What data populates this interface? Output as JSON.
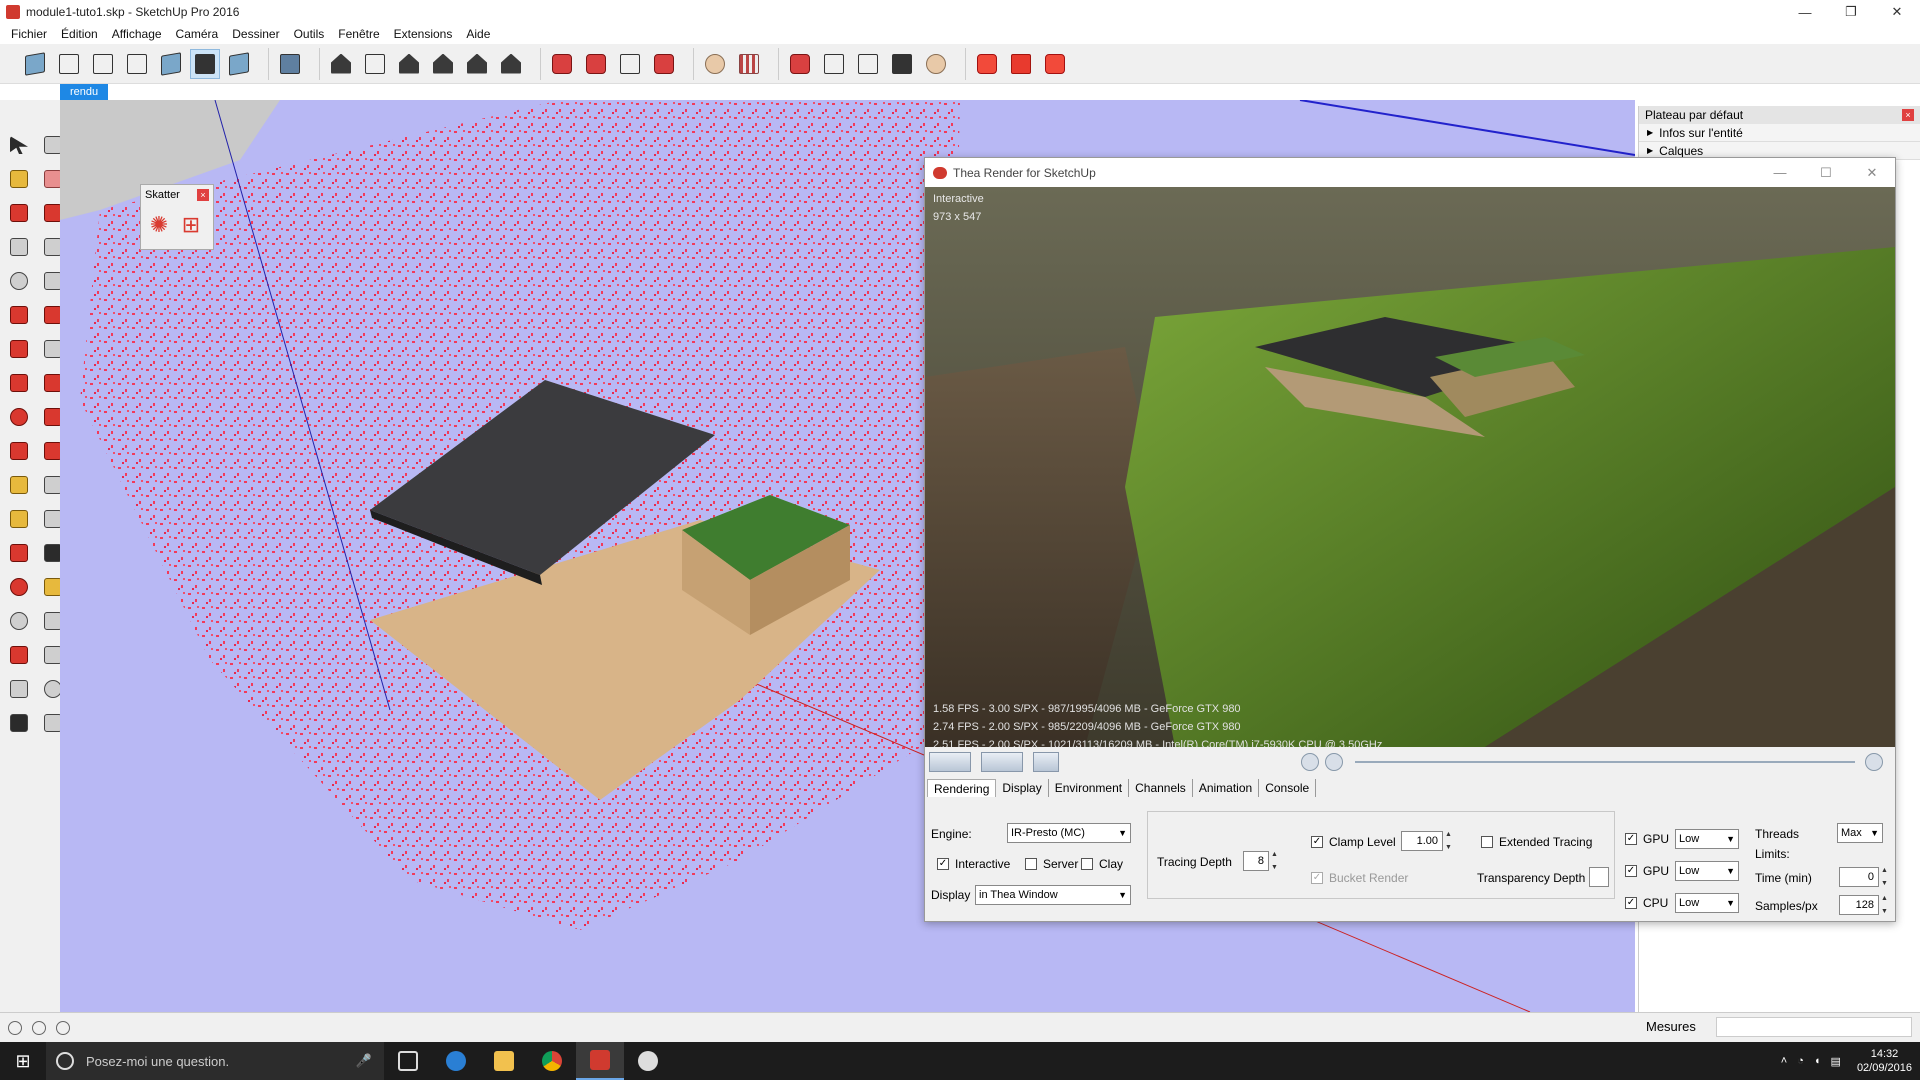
{
  "window": {
    "title": "module1-tuto1.skp - SketchUp Pro 2016",
    "controls": [
      "—",
      "❐",
      "✕"
    ]
  },
  "menu": [
    "Fichier",
    "Édition",
    "Affichage",
    "Caméra",
    "Dessiner",
    "Outils",
    "Fenêtre",
    "Extensions",
    "Aide"
  ],
  "scene_tab": "rendu",
  "skatter": {
    "title": "Skatter",
    "close": "×"
  },
  "tray": {
    "title": "Plateau par défaut",
    "items": [
      "Infos sur l'entité",
      "Calques"
    ]
  },
  "thea": {
    "title": "Thea Render for SketchUp",
    "mode_label": "Interactive",
    "resolution": "973 x 547",
    "stats": [
      "1.58 FPS - 3.00 S/PX - 987/1995/4096 MB - GeForce GTX 980",
      "2.74 FPS - 2.00 S/PX - 985/2209/4096 MB - GeForce GTX 980",
      "2.51 FPS - 2.00 S/PX - 1021/3113/16209 MB - Intel(R) Core(TM) i7-5930K CPU @ 3.50GHz"
    ],
    "tabs": [
      "Rendering",
      "Display",
      "Environment",
      "Channels",
      "Animation",
      "Console"
    ],
    "settings": {
      "engine_label": "Engine:",
      "engine_value": "IR-Presto (MC)",
      "interactive_label": "Interactive",
      "server_label": "Server",
      "clay_label": "Clay",
      "display_label": "Display",
      "display_value": "in Thea Window",
      "tracing_depth_label": "Tracing Depth",
      "tracing_depth_value": "8",
      "clamp_level_label": "Clamp Level",
      "clamp_level_value": "1.00",
      "bucket_render_label": "Bucket Render",
      "extended_tracing_label": "Extended Tracing",
      "transparency_depth_label": "Transparency Depth",
      "devices": [
        {
          "label": "GPU",
          "value": "Low"
        },
        {
          "label": "GPU",
          "value": "Low"
        },
        {
          "label": "CPU",
          "value": "Low"
        }
      ],
      "threads_label": "Threads",
      "threads_value": "Max",
      "limits_label": "Limits:",
      "time_label": "Time (min)",
      "time_value": "0",
      "samples_label": "Samples/px",
      "samples_value": "128"
    }
  },
  "status": {
    "measures_label": "Mesures"
  },
  "taskbar": {
    "search_placeholder": "Posez-moi une question.",
    "time": "14:32",
    "date": "02/09/2016"
  }
}
